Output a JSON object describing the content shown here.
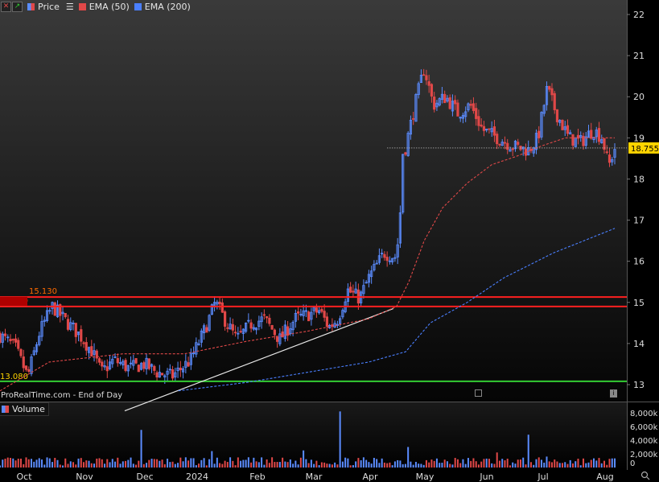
{
  "toolbar": {
    "price_label": "Price",
    "ema50_label": "EMA (50)",
    "ema200_label": "EMA (200)",
    "icons": [
      "close-icon",
      "trend-icon",
      "menu-icon"
    ]
  },
  "watermark": "ProRealTime.com - End of Day",
  "volume_label": "Volume",
  "colors": {
    "up": "#5b8cff",
    "down": "#e04848",
    "ema50": "#e04848",
    "ema200": "#4a7fff",
    "resistance": "#ff2020",
    "support": "#33cc33",
    "last_price_bg": "#ffd400"
  },
  "chart_data": [
    {
      "type": "candlestick",
      "ylim": [
        12.8,
        22.2
      ],
      "yticks": [
        "22",
        "21",
        "20",
        "19",
        "18",
        "17",
        "16",
        "15",
        "14",
        "13"
      ],
      "xticks": [
        "Oct",
        "Nov",
        "Dec",
        "2024",
        "Feb",
        "Mar",
        "Apr",
        "May",
        "Jun",
        "Jul",
        "Aug"
      ],
      "last_price": "18.755",
      "levels": [
        {
          "label": "15.130",
          "value": 15.13
        },
        {
          "label": "14.900",
          "value": 14.9
        },
        {
          "label": "13.080",
          "value": 13.08
        }
      ],
      "trendline": [
        [
          0.0,
          12.95
        ],
        [
          0.64,
          14.85
        ]
      ],
      "anchors": [
        [
          0.0,
          14.2
        ],
        [
          0.025,
          13.9
        ],
        [
          0.045,
          13.2
        ],
        [
          0.065,
          14.3
        ],
        [
          0.085,
          14.9
        ],
        [
          0.11,
          14.5
        ],
        [
          0.13,
          14.2
        ],
        [
          0.15,
          13.8
        ],
        [
          0.165,
          13.3
        ],
        [
          0.185,
          13.6
        ],
        [
          0.21,
          13.4
        ],
        [
          0.235,
          13.5
        ],
        [
          0.255,
          13.3
        ],
        [
          0.28,
          13.2
        ],
        [
          0.31,
          13.6
        ],
        [
          0.335,
          14.4
        ],
        [
          0.35,
          15.0
        ],
        [
          0.365,
          14.6
        ],
        [
          0.385,
          14.1
        ],
        [
          0.41,
          14.5
        ],
        [
          0.43,
          14.6
        ],
        [
          0.455,
          14.1
        ],
        [
          0.48,
          14.6
        ],
        [
          0.5,
          14.7
        ],
        [
          0.52,
          14.8
        ],
        [
          0.535,
          14.4
        ],
        [
          0.55,
          14.6
        ],
        [
          0.565,
          15.3
        ],
        [
          0.585,
          15.1
        ],
        [
          0.6,
          15.6
        ],
        [
          0.625,
          16.2
        ],
        [
          0.645,
          16.1
        ],
        [
          0.66,
          18.8
        ],
        [
          0.675,
          19.8
        ],
        [
          0.69,
          20.7
        ],
        [
          0.705,
          19.8
        ],
        [
          0.725,
          20.0
        ],
        [
          0.745,
          19.6
        ],
        [
          0.765,
          19.8
        ],
        [
          0.785,
          19.2
        ],
        [
          0.81,
          19.0
        ],
        [
          0.835,
          18.8
        ],
        [
          0.86,
          18.7
        ],
        [
          0.875,
          19.0
        ],
        [
          0.89,
          20.2
        ],
        [
          0.905,
          19.6
        ],
        [
          0.925,
          19.0
        ],
        [
          0.945,
          18.9
        ],
        [
          0.965,
          19.2
        ],
        [
          0.98,
          19.0
        ],
        [
          0.99,
          18.3
        ],
        [
          1.0,
          18.75
        ]
      ],
      "ema50": [
        [
          0.0,
          12.85
        ],
        [
          0.08,
          13.55
        ],
        [
          0.2,
          13.75
        ],
        [
          0.3,
          13.75
        ],
        [
          0.4,
          14.05
        ],
        [
          0.5,
          14.3
        ],
        [
          0.6,
          14.6
        ],
        [
          0.645,
          14.9
        ],
        [
          0.665,
          15.5
        ],
        [
          0.69,
          16.5
        ],
        [
          0.72,
          17.3
        ],
        [
          0.76,
          17.9
        ],
        [
          0.8,
          18.35
        ],
        [
          0.84,
          18.55
        ],
        [
          0.88,
          18.8
        ],
        [
          0.92,
          19.0
        ],
        [
          1.0,
          19.0
        ]
      ],
      "ema200": [
        [
          0.29,
          12.85
        ],
        [
          0.4,
          13.05
        ],
        [
          0.5,
          13.3
        ],
        [
          0.6,
          13.55
        ],
        [
          0.66,
          13.8
        ],
        [
          0.7,
          14.5
        ],
        [
          0.76,
          15.0
        ],
        [
          0.82,
          15.6
        ],
        [
          0.9,
          16.2
        ],
        [
          1.0,
          16.8
        ]
      ]
    },
    {
      "type": "bar",
      "title": "Volume",
      "yticks": [
        "8,000k",
        "6,000k",
        "4,000k",
        "2,000k",
        "0"
      ],
      "ylim": [
        0,
        9000
      ],
      "spikes": [
        [
          0.23,
          5500
        ],
        [
          0.345,
          2400
        ],
        [
          0.495,
          2500
        ],
        [
          0.555,
          8200
        ],
        [
          0.665,
          3000
        ],
        [
          0.81,
          2200
        ],
        [
          0.86,
          4800
        ],
        [
          0.89,
          1600
        ]
      ]
    }
  ]
}
